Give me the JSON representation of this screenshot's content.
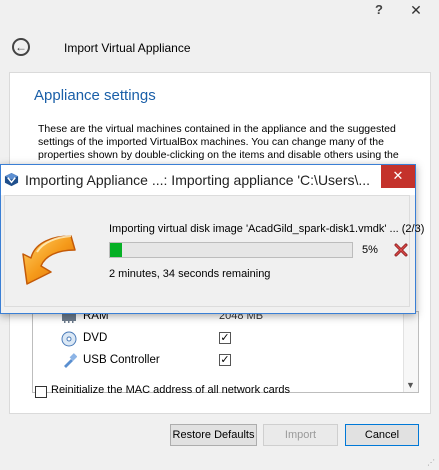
{
  "window": {
    "help_glyph": "?",
    "close_glyph": "✕"
  },
  "wizard": {
    "back_glyph": "←",
    "title": "Import Virtual Appliance",
    "section_title": "Appliance settings",
    "description": "These are the virtual machines contained in the appliance and the suggested settings of the imported VirtualBox machines. You can change many of the properties shown by double-clicking on the items and disable others using the",
    "vm_rows": [
      {
        "label": "RAM",
        "value": "2048 MB"
      },
      {
        "label": "DVD",
        "checked": true
      },
      {
        "label": "USB Controller",
        "checked": true
      }
    ],
    "mac_checkbox_label": "Reinitialize the MAC address of all network cards",
    "buttons": {
      "restore": "Restore Defaults",
      "import": "Import",
      "cancel": "Cancel"
    }
  },
  "dialog": {
    "title": "Importing Appliance ...: Importing appliance 'C:\\Users\\...",
    "close_glyph": "✕",
    "progress_text": "Importing virtual disk image 'AcadGild_spark-disk1.vmdk' ... (2/3)",
    "progress_percent": 5,
    "progress_label": "5%",
    "remaining": "2 minutes, 34 seconds remaining"
  },
  "colors": {
    "accent": "#1a5fa8",
    "progress": "#06b025",
    "close_red": "#c4322b",
    "logo_orange": "#f08a12"
  },
  "icons": {
    "app": "virtualbox-icon",
    "logo": "import-arrow-icon",
    "cancel": "cancel-x-icon"
  }
}
